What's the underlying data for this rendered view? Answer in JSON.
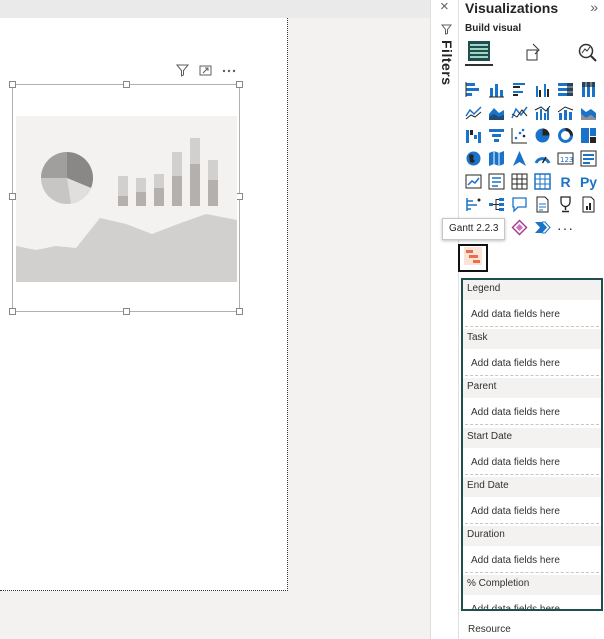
{
  "filters": {
    "label": "Filters",
    "close_glyph": "×",
    "icon": "filter-icon"
  },
  "visualizations": {
    "title": "Visualizations",
    "collapse_glyph": "»",
    "build_visual_label": "Build visual",
    "tabs": [
      "build-visual-icon",
      "format-visual-icon",
      "analytics-icon"
    ],
    "gallery_text": {
      "r": "R",
      "py": "Py",
      "more": "···"
    },
    "tooltip": "Gantt 2.2.3"
  },
  "field_wells": [
    {
      "label": "Legend",
      "placeholder": "Add data fields here"
    },
    {
      "label": "Task",
      "placeholder": "Add data fields here"
    },
    {
      "label": "Parent",
      "placeholder": "Add data fields here"
    },
    {
      "label": "Start Date",
      "placeholder": "Add data fields here"
    },
    {
      "label": "End Date",
      "placeholder": "Add data fields here"
    },
    {
      "label": "Duration",
      "placeholder": "Add data fields here"
    },
    {
      "label": "% Completion",
      "placeholder": "Add data fields here"
    }
  ],
  "resource_label": "Resource",
  "colors": {
    "accent": "#1a73c8",
    "well_border": "#1f4e4f",
    "gantt_orange": "#e5704b"
  }
}
